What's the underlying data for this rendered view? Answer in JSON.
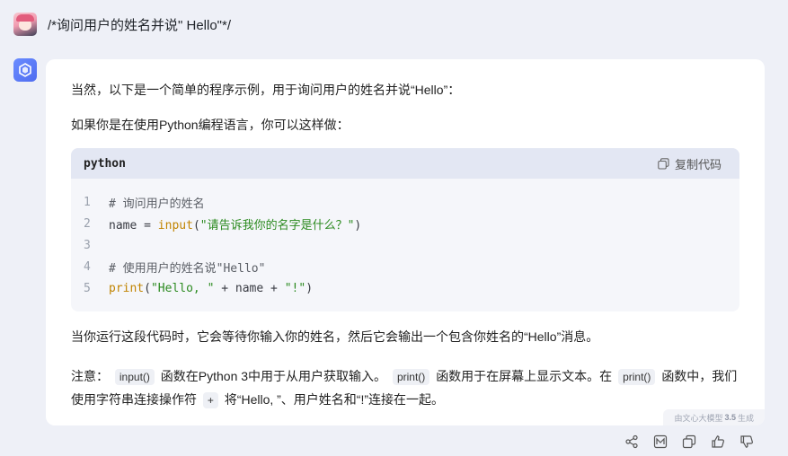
{
  "user": {
    "message": "/*询问用户的姓名并说\" Hello\"*/"
  },
  "answer": {
    "intro": "当然，以下是一个简单的程序示例，用于询问用户的姓名并说“Hello”：",
    "lead": "如果你是在使用Python编程语言，你可以这样做：",
    "code_block": {
      "language": "python",
      "copy_label": "复制代码",
      "lines": [
        {
          "num": "1",
          "text": "# 询问用户的姓名"
        },
        {
          "num": "2",
          "text": "name = input(\"请告诉我你的名字是什么？\")"
        },
        {
          "num": "3",
          "text": ""
        },
        {
          "num": "4",
          "text": "# 使用用户的姓名说\"Hello\""
        },
        {
          "num": "5",
          "text": "print(\"Hello, \" + name + \"!\")"
        }
      ]
    },
    "explanation": "当你运行这段代码时，它会等待你输入你的姓名，然后它会输出一个包含你姓名的“Hello”消息。",
    "note": {
      "prefix": "注意：",
      "code1": "input()",
      "t1": "函数在Python 3中用于从用户获取输入。",
      "code2": "print()",
      "t2": "函数用于在屏幕上显示文本。在",
      "code3": "print()",
      "t3": "函数中，我们使用字符串连接操作符",
      "code4": "+",
      "t4": "将“Hello, ”、用户姓名和“!”连接在一起。"
    },
    "watermark": {
      "prefix": "由文心大模型",
      "version": "3.5",
      "suffix": "生成"
    }
  },
  "actions": [
    "share-icon",
    "image-icon",
    "copy-icon",
    "thumbs-up-icon",
    "thumbs-down-icon"
  ]
}
